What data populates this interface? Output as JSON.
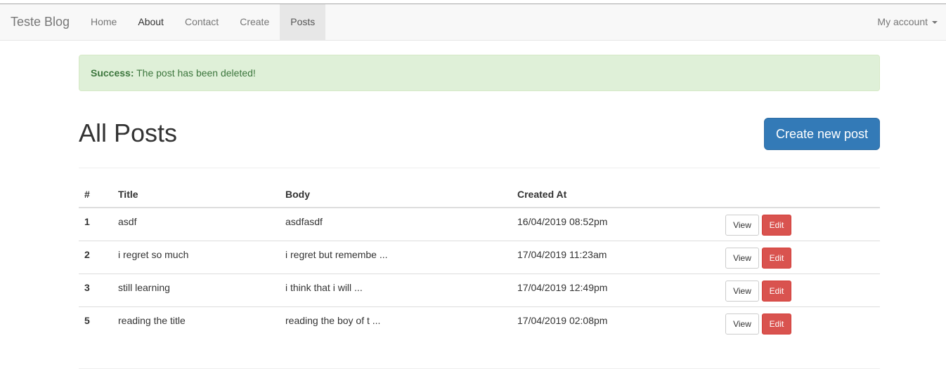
{
  "navbar": {
    "brand": "Teste Blog",
    "items": [
      {
        "label": "Home"
      },
      {
        "label": "About"
      },
      {
        "label": "Contact"
      },
      {
        "label": "Create"
      },
      {
        "label": "Posts"
      }
    ],
    "active_item": "Posts",
    "account_label": "My account"
  },
  "alert": {
    "strong": "Success:",
    "message": " The post has been deleted!"
  },
  "page": {
    "title": "All Posts",
    "create_button": "Create new post"
  },
  "table": {
    "headers": [
      "#",
      "Title",
      "Body",
      "Created At"
    ],
    "rows": [
      {
        "id": "1",
        "title": "asdf",
        "body": "asdfasdf",
        "created_at": "16/04/2019 08:52pm",
        "view": "View",
        "edit": "Edit"
      },
      {
        "id": "2",
        "title": "i regret so much",
        "body": "i regret but remembe ...",
        "created_at": "17/04/2019 11:23am",
        "view": "View",
        "edit": "Edit"
      },
      {
        "id": "3",
        "title": "still learning",
        "body": "i think that i will ...",
        "created_at": "17/04/2019 12:49pm",
        "view": "View",
        "edit": "Edit"
      },
      {
        "id": "5",
        "title": "reading the title",
        "body": "reading the boy of t ...",
        "created_at": "17/04/2019 02:08pm",
        "view": "View",
        "edit": "Edit"
      }
    ]
  },
  "colors": {
    "primary": "#337ab7",
    "danger": "#d9534f",
    "success_bg": "#dff0d8",
    "success_text": "#3c763d",
    "navbar_bg": "#f8f8f8"
  },
  "icons": {
    "account_dropdown": "caret-down-icon"
  }
}
